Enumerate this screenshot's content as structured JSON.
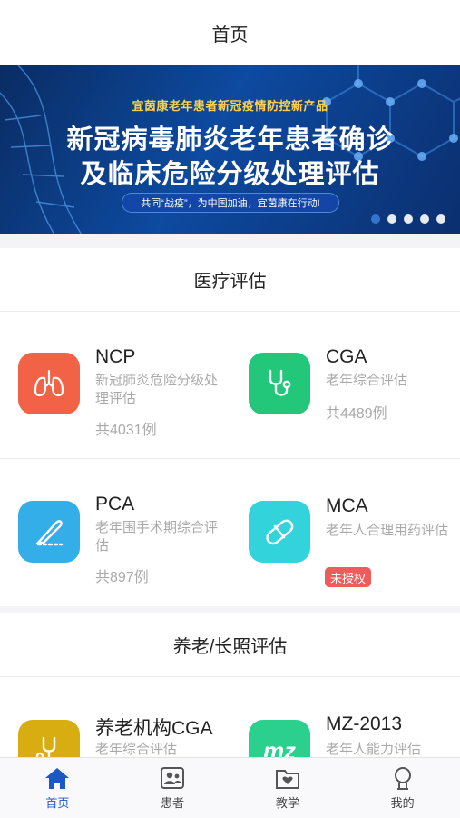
{
  "header": {
    "title": "首页"
  },
  "banner": {
    "subtitle": "宜茵康老年患者新冠疫情防控新产品",
    "title_line1": "新冠病毒肺炎老年患者确诊",
    "title_line2": "及临床危险分级处理评估",
    "slogan": "共同“战疫”，为中国加油，宜茵康在行动!",
    "slide_count": 5,
    "active_slide": 1
  },
  "sections": {
    "medical": {
      "title": "医疗评估",
      "cards": [
        {
          "name": "NCP",
          "desc": "新冠肺炎危险分级处理评估",
          "count": "共4031例",
          "icon": "lungs-icon",
          "color": "#f26247"
        },
        {
          "name": "CGA",
          "desc": "老年综合评估",
          "count": "共4489例",
          "icon": "stethoscope-icon",
          "color": "#22c77a"
        },
        {
          "name": "PCA",
          "desc": "老年围手术期综合评估",
          "count": "共897例",
          "icon": "scalpel-icon",
          "color": "#34aee8"
        },
        {
          "name": "MCA",
          "desc": "老年人合理用药评估",
          "badge": "未授权",
          "icon": "pill-capsule-icon",
          "color": "#33d3db"
        }
      ]
    },
    "elderly": {
      "title": "养老/长照评估",
      "cards": [
        {
          "name": "养老机构CGA",
          "desc": "老年综合评估",
          "icon": "stethoscope-icon",
          "color": "#d8ad12"
        },
        {
          "name": "MZ-2013",
          "desc": "老年人能力评估",
          "icon": "mz-logo-icon",
          "icon_text": "mz",
          "color": "#2bd08f"
        }
      ]
    }
  },
  "tabbar": {
    "items": [
      {
        "label": "首页",
        "icon": "home-icon",
        "active": true
      },
      {
        "label": "患者",
        "icon": "patient-card-icon",
        "active": false
      },
      {
        "label": "教学",
        "icon": "teaching-folder-icon",
        "active": false
      },
      {
        "label": "我的",
        "icon": "profile-icon",
        "active": false
      }
    ]
  },
  "colors": {
    "accent": "#1a57c7",
    "badge": "#ef5a5a"
  }
}
